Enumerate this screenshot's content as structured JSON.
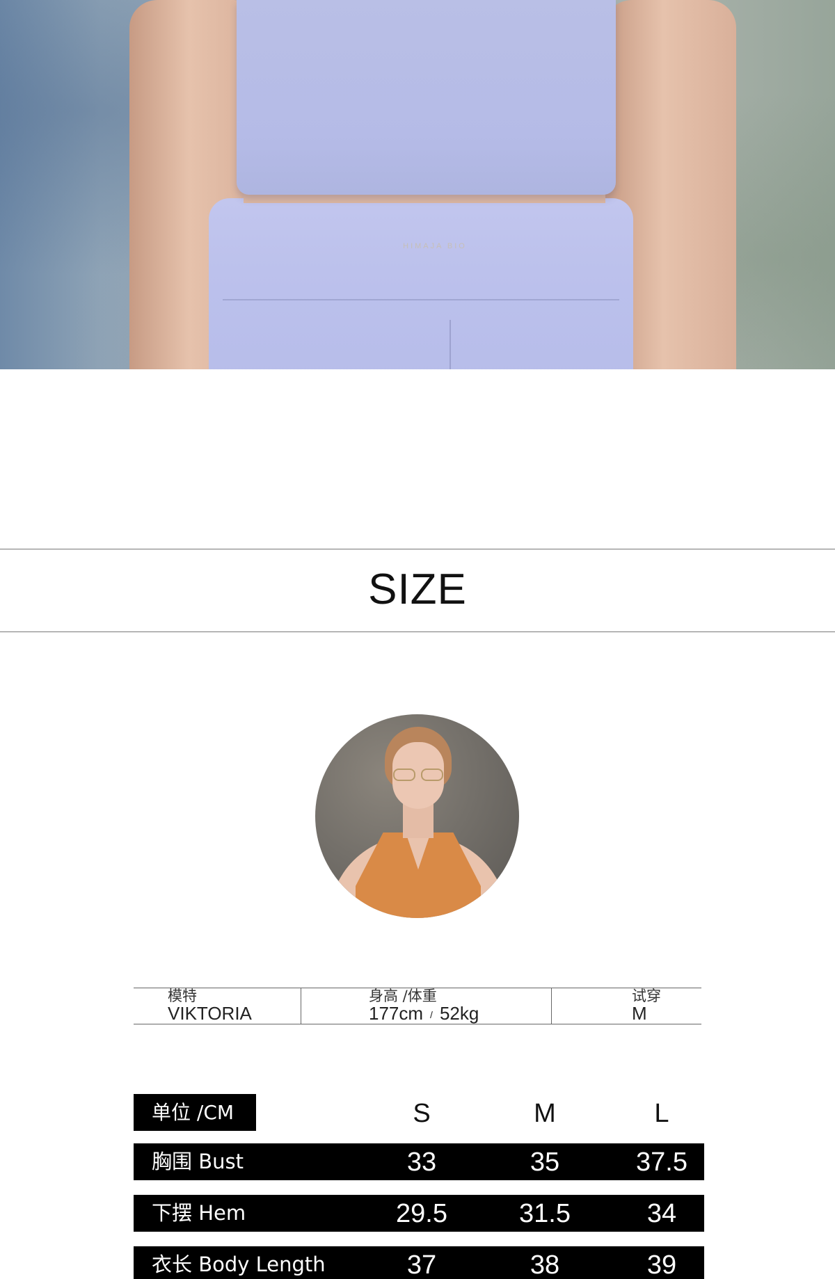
{
  "hero": {
    "brand_print": "HIMAJA BIO"
  },
  "size_header": {
    "title": "SIZE"
  },
  "model_info": {
    "model_label": "模特",
    "model_name": "VIKTORIA",
    "height_weight_label": "身高 /体重",
    "height": "177cm",
    "separator": "/",
    "weight": "52kg",
    "fitting_label": "试穿",
    "fitting_size": "M"
  },
  "size_chart": {
    "unit_label": "单位 /CM",
    "sizes": [
      "S",
      "M",
      "L"
    ],
    "rows": [
      {
        "label": "胸围 Bust",
        "values": [
          "33",
          "35",
          "37.5"
        ]
      },
      {
        "label": "下摆 Hem",
        "values": [
          "29.5",
          "31.5",
          "34"
        ]
      },
      {
        "label": "衣长 Body Length",
        "values": [
          "37",
          "38",
          "39"
        ]
      }
    ]
  }
}
